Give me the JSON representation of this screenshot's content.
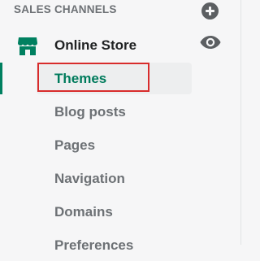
{
  "sidebar": {
    "section_header": "SALES CHANNELS",
    "online_store": {
      "label": "Online Store"
    },
    "items": [
      {
        "label": "Themes",
        "active": true
      },
      {
        "label": "Blog posts",
        "active": false
      },
      {
        "label": "Pages",
        "active": false
      },
      {
        "label": "Navigation",
        "active": false
      },
      {
        "label": "Domains",
        "active": false
      },
      {
        "label": "Preferences",
        "active": false
      }
    ]
  },
  "icons": {
    "add": "plus-circle-icon",
    "store": "store-icon",
    "view": "eye-icon"
  },
  "colors": {
    "accent_green": "#008060",
    "active_text": "#007b5c",
    "muted_text": "#6d7175",
    "primary_text": "#202223",
    "highlight_red": "#d82c2c"
  }
}
